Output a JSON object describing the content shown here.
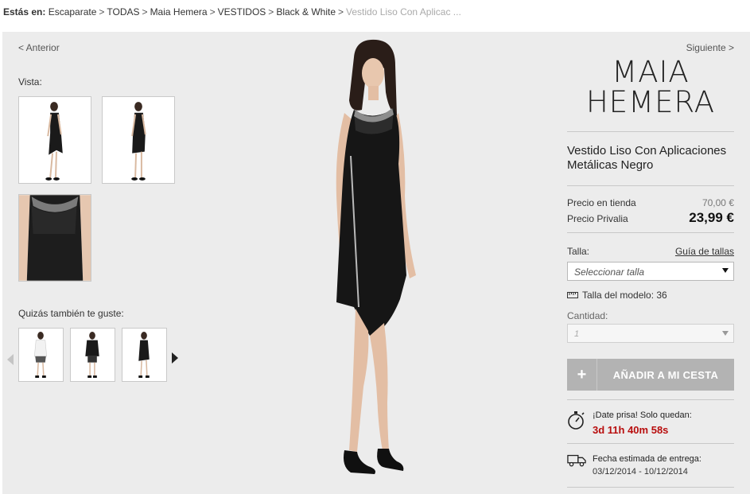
{
  "breadcrumb": {
    "prefix": "Estás en:",
    "items": [
      "Escaparate",
      "TODAS",
      "Maia Hemera",
      "VESTIDOS",
      "Black & White"
    ],
    "current": "Vestido Liso Con Aplicac ..."
  },
  "nav": {
    "prev": "< Anterior",
    "next": "Siguiente >"
  },
  "gallery": {
    "label": "Vista:"
  },
  "suggestions": {
    "label": "Quizás también te guste:"
  },
  "product": {
    "brand_line1": "MAIA",
    "brand_line2": "HEMERA",
    "name": "Vestido Liso Con Aplicaciones Metálicas Negro",
    "price_store_label": "Precio en tienda",
    "price_store": "70,00 €",
    "price_privalia_label": "Precio Privalia",
    "price_privalia": "23,99 €"
  },
  "size": {
    "label": "Talla:",
    "guide_link": "Guía de tallas",
    "select_value": "Seleccionar talla",
    "model_size": "Talla del modelo: 36"
  },
  "quantity": {
    "label": "Cantidad:",
    "value": "1"
  },
  "cart": {
    "plus": "+",
    "label": "AÑADIR A MI CESTA"
  },
  "urgency": {
    "title": "¡Date prisa! Solo quedan:",
    "countdown": "3d 11h 40m 58s"
  },
  "delivery": {
    "title": "Fecha estimada de entrega:",
    "dates": "03/12/2014 - 10/12/2014"
  },
  "colors": {
    "countdown": "#b80d0d",
    "button": "#b3b3b3",
    "panel": "#ececec"
  }
}
